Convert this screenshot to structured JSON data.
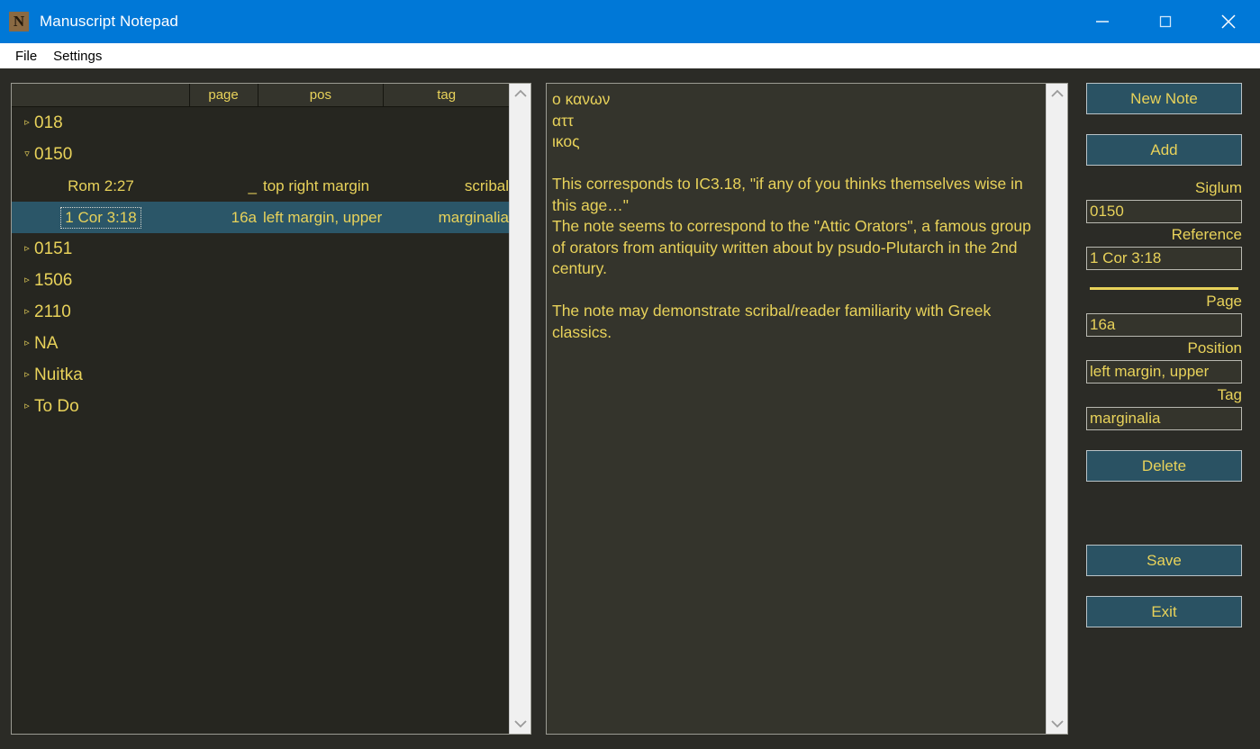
{
  "window": {
    "title": "Manuscript Notepad",
    "icon": "app-icon-n",
    "icon_letter": "N",
    "titlebar_color": "#0078d7",
    "controls": {
      "minimize": "minimize-icon",
      "maximize": "maximize-icon",
      "close": "close-icon"
    }
  },
  "menubar": {
    "items": [
      {
        "label": "File"
      },
      {
        "label": "Settings"
      }
    ]
  },
  "tree": {
    "columns": [
      "",
      "page",
      "pos",
      "tag"
    ],
    "rows": [
      {
        "type": "node",
        "expander": "▹",
        "expanded": false,
        "label": "018"
      },
      {
        "type": "node",
        "expander": "▿",
        "expanded": true,
        "label": "0150"
      },
      {
        "type": "child",
        "selected": false,
        "ref": "Rom 2:27",
        "page": "_",
        "pos": "top right margin",
        "tag": "scribal"
      },
      {
        "type": "child",
        "selected": true,
        "ref": "1 Cor 3:18",
        "page": "16a",
        "pos": "left margin, upper",
        "tag": "marginalia"
      },
      {
        "type": "node",
        "expander": "▹",
        "expanded": false,
        "label": "0151"
      },
      {
        "type": "node",
        "expander": "▹",
        "expanded": false,
        "label": "1506"
      },
      {
        "type": "node",
        "expander": "▹",
        "expanded": false,
        "label": "2110"
      },
      {
        "type": "node",
        "expander": "▹",
        "expanded": false,
        "label": "NA"
      },
      {
        "type": "node",
        "expander": "▹",
        "expanded": false,
        "label": "Nuitka"
      },
      {
        "type": "node",
        "expander": "▹",
        "expanded": false,
        "label": "To Do"
      }
    ]
  },
  "editor": {
    "content": "ο κανων\nαττ\nικος\n\nThis corresponds to IC3.18, \"if any of you thinks themselves wise in this age…\"\nThe note seems to correspond to the \"Attic Orators\", a famous group of orators from antiquity written about by psudo-Plutarch in the 2nd century.\n\nThe note may demonstrate scribal/reader familiarity with Greek classics."
  },
  "sidepanel": {
    "new_note_label": "New Note",
    "add_label": "Add",
    "siglum_label": "Siglum",
    "siglum_value": "0150",
    "reference_label": "Reference",
    "reference_value": "1 Cor 3:18",
    "page_label": "Page",
    "page_value": "16a",
    "position_label": "Position",
    "position_value": "left margin, upper",
    "tag_label": "Tag",
    "tag_value": "marginalia",
    "delete_label": "Delete",
    "save_label": "Save",
    "exit_label": "Exit"
  },
  "colors": {
    "accent_text": "#e8d25a",
    "button_bg": "#2a5263",
    "selection_bg": "#2b5668",
    "panel_bg": "#34342c",
    "window_bg": "#2b2b26",
    "titlebar": "#0078d7"
  }
}
